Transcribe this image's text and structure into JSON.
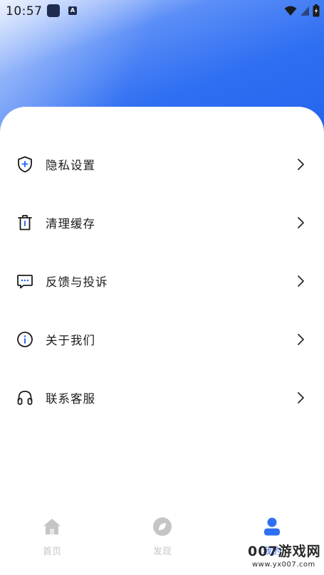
{
  "status_bar": {
    "time": "10:57",
    "app_badge": "A"
  },
  "menu": {
    "items": [
      {
        "label": "隐私设置",
        "icon": "shield-plus-icon"
      },
      {
        "label": "清理缓存",
        "icon": "trash-icon"
      },
      {
        "label": "反馈与投诉",
        "icon": "chat-bubble-icon"
      },
      {
        "label": "关于我们",
        "icon": "info-circle-icon"
      },
      {
        "label": "联系客服",
        "icon": "headset-icon"
      }
    ]
  },
  "tabbar": {
    "tabs": [
      {
        "label": "首页",
        "icon": "home-icon",
        "active": false
      },
      {
        "label": "发现",
        "icon": "compass-icon",
        "active": false
      },
      {
        "label": "我的",
        "icon": "user-icon",
        "active": true
      }
    ]
  },
  "watermark": {
    "title": "007游戏网",
    "url": "www.yx007.com"
  },
  "colors": {
    "accent": "#2f6ff2",
    "tab_inactive": "#c5c5c5",
    "text": "#1c1c1c"
  }
}
